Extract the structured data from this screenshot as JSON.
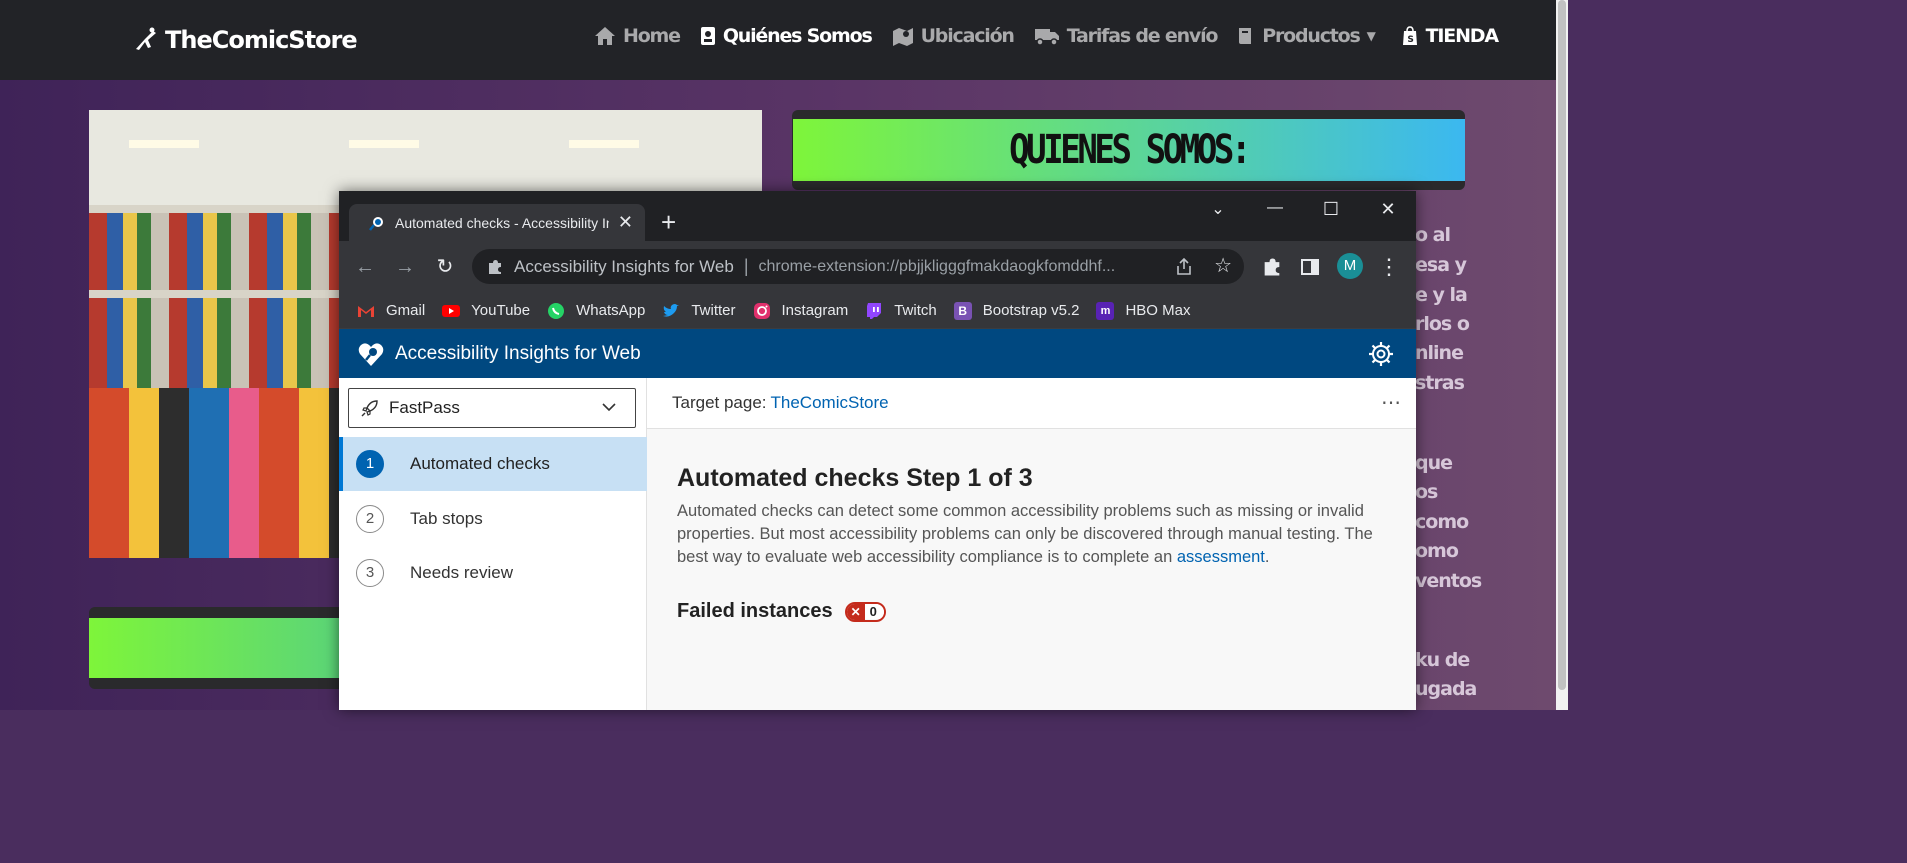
{
  "site": {
    "brand": "TheComicStore",
    "nav": [
      {
        "label": "Home",
        "icon": "home-icon"
      },
      {
        "label": "Quiénes Somos",
        "icon": "id-card-icon"
      },
      {
        "label": "Ubicación",
        "icon": "map-icon"
      },
      {
        "label": "Tarifas de envío",
        "icon": "truck-icon"
      },
      {
        "label": "Productos",
        "icon": "book-icon"
      },
      {
        "label": "TIENDA",
        "icon": "shopify-icon"
      }
    ],
    "banner_title": "QUIENES SOMOS:",
    "side_text": [
      "o al",
      "esa y",
      "e y la",
      "rlos o",
      "nline",
      "stras",
      "que",
      "os",
      "como",
      "omo",
      "ventos",
      "ku de",
      "ugada"
    ]
  },
  "browser": {
    "tab_title": "Automated checks - Accessibility Insights for Web",
    "new_tab": "+",
    "site_name": "Accessibility Insights for Web",
    "url": "chrome-extension://pbjjkligggfmakdaogkfomddhf...",
    "profile_initial": "M",
    "bookmarks": [
      {
        "label": "Gmail",
        "icon": "gmail-icon",
        "color": "#ea4335"
      },
      {
        "label": "YouTube",
        "icon": "youtube-icon",
        "color": "#ff0000"
      },
      {
        "label": "WhatsApp",
        "icon": "whatsapp-icon",
        "color": "#25d366"
      },
      {
        "label": "Twitter",
        "icon": "twitter-icon",
        "color": "#1d9bf0"
      },
      {
        "label": "Instagram",
        "icon": "instagram-icon",
        "color": "#e1306c"
      },
      {
        "label": "Twitch",
        "icon": "twitch-icon",
        "color": "#9146ff"
      },
      {
        "label": "Bootstrap v5.2",
        "icon": "bootstrap-icon",
        "color": "#7952b3"
      },
      {
        "label": "HBO Max",
        "icon": "hbomax-icon",
        "color": "#5822b4"
      }
    ]
  },
  "extension": {
    "title": "Accessibility Insights for Web",
    "mode": "FastPass",
    "steps": [
      {
        "number": "1",
        "label": "Automated checks"
      },
      {
        "number": "2",
        "label": "Tab stops"
      },
      {
        "number": "3",
        "label": "Needs review"
      }
    ],
    "target_label": "Target page:",
    "target_link": "TheComicStore",
    "more": "⋯",
    "heading": "Automated checks Step 1 of 3",
    "description": "Automated checks can detect some common accessibility problems such as missing or invalid properties. But most accessibility problems can only be discovered through manual testing. The best way to evaluate web accessibility compliance is to complete an",
    "description_link": "assessment",
    "description_end": ".",
    "failed_label": "Failed instances",
    "failed_count": "0"
  }
}
